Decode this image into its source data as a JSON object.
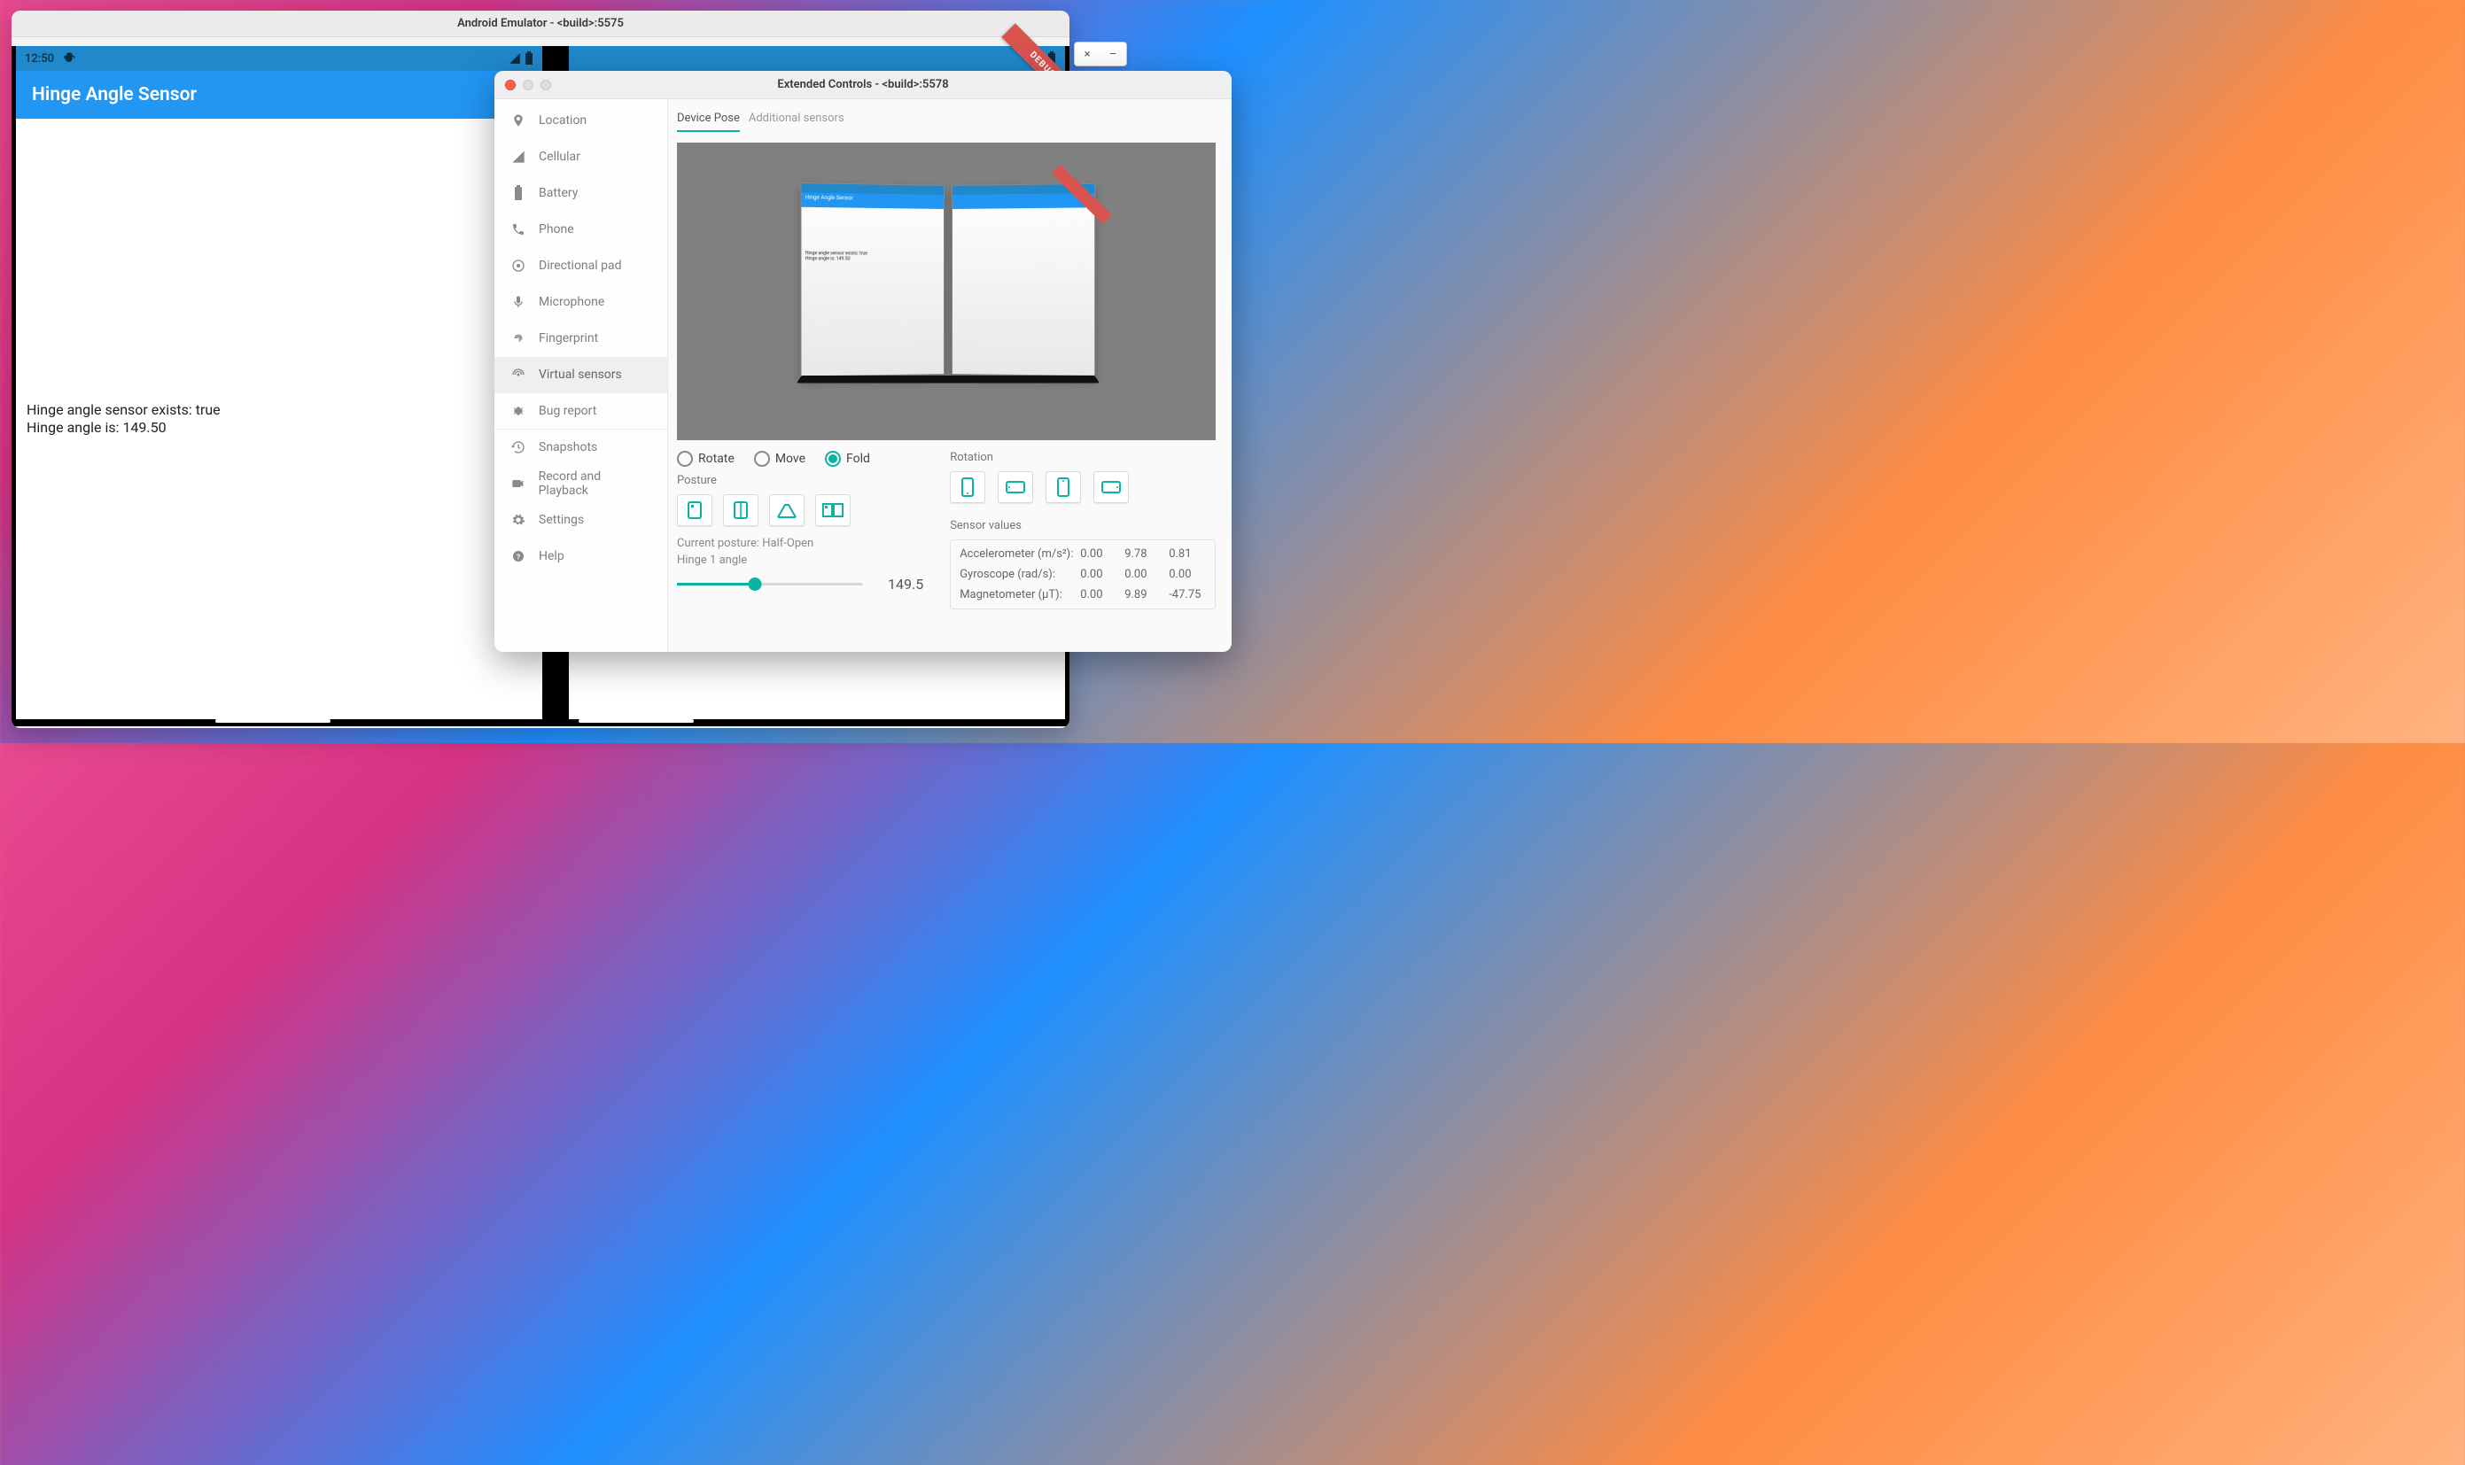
{
  "emulator": {
    "window_title": "Android Emulator - <build>:5575",
    "status_time": "12:50",
    "app_title": "Hinge Angle Sensor",
    "body_line1": "Hinge angle sensor exists: true",
    "body_line2": "Hinge angle is: 149.50",
    "debug_ribbon": "DEBUG"
  },
  "mini_window": {
    "close": "×",
    "min": "–"
  },
  "extended": {
    "window_title": "Extended Controls - <build>:5578",
    "sidebar": [
      {
        "id": "location",
        "label": "Location"
      },
      {
        "id": "cellular",
        "label": "Cellular"
      },
      {
        "id": "battery",
        "label": "Battery"
      },
      {
        "id": "phone",
        "label": "Phone"
      },
      {
        "id": "dpad",
        "label": "Directional pad"
      },
      {
        "id": "microphone",
        "label": "Microphone"
      },
      {
        "id": "fingerprint",
        "label": "Fingerprint"
      },
      {
        "id": "virtual-sensors",
        "label": "Virtual sensors"
      },
      {
        "id": "bug-report",
        "label": "Bug report"
      },
      {
        "id": "snapshots",
        "label": "Snapshots"
      },
      {
        "id": "record",
        "label": "Record and Playback"
      },
      {
        "id": "settings",
        "label": "Settings"
      },
      {
        "id": "help",
        "label": "Help"
      }
    ],
    "tabs": {
      "device_pose": "Device Pose",
      "additional": "Additional sensors"
    },
    "preview": {
      "mini_title": "Hinge Angle Sensor",
      "mini_line1": "Hinge angle sensor exists: true",
      "mini_line2": "Hinge angle is: 149.50"
    },
    "mode": {
      "rotate": "Rotate",
      "move": "Move",
      "fold": "Fold",
      "selected": "fold"
    },
    "posture": {
      "label": "Posture",
      "current_label": "Current posture: Half-Open",
      "hinge_label": "Hinge 1 angle",
      "hinge_value": "149.5",
      "hinge_fraction": 0.42
    },
    "rotation": {
      "label": "Rotation"
    },
    "sensors": {
      "heading": "Sensor values",
      "accel_label": "Accelerometer (m/s²):",
      "accel": [
        "0.00",
        "9.78",
        "0.81"
      ],
      "gyro_label": "Gyroscope (rad/s):",
      "gyro": [
        "0.00",
        "0.00",
        "0.00"
      ],
      "mag_label": "Magnetometer (µT):",
      "mag": [
        "0.00",
        "9.89",
        "-47.75"
      ]
    }
  }
}
